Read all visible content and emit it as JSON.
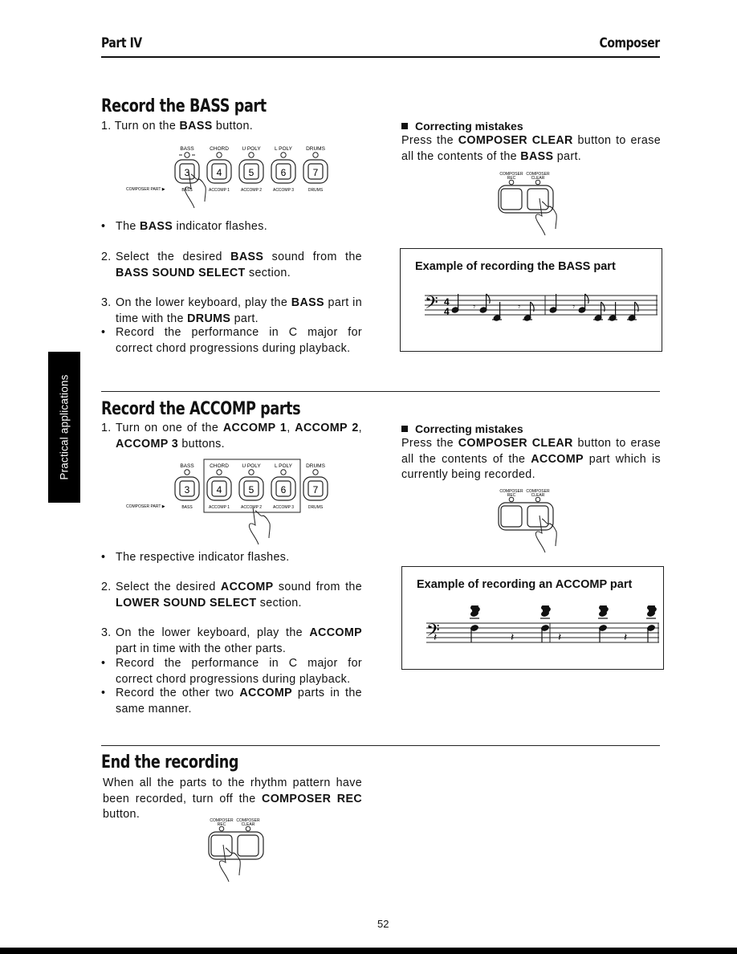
{
  "header": {
    "left": "Part IV",
    "right": "Composer"
  },
  "side_tab": "Practical applications",
  "page_number": "52",
  "panel": {
    "composer_part_label": "COMPOSER PART ▶",
    "buttons": [
      {
        "top": "BASS",
        "num": "3",
        "bottom": "BASS"
      },
      {
        "top": "CHORD",
        "num": "4",
        "bottom": "ACCOMP 1"
      },
      {
        "top": "U POLY",
        "num": "5",
        "bottom": "ACCOMP 2"
      },
      {
        "top": "L POLY",
        "num": "6",
        "bottom": "ACCOMP 3"
      },
      {
        "top": "DRUMS",
        "num": "7",
        "bottom": "DRUMS"
      }
    ],
    "composer_rec_top": "COMPOSER",
    "composer_rec_bottom": "REC",
    "composer_clear_top": "COMPOSER",
    "composer_clear_bottom": "CLEAR"
  },
  "bass": {
    "title": "Record the BASS part",
    "step1": {
      "num": "1.",
      "pre": "Turn on the ",
      "b1": "BASS",
      "post": " button."
    },
    "bullet1": {
      "pre": "The ",
      "b1": "BASS",
      "post": " indicator flashes."
    },
    "step2": {
      "num": "2.",
      "pre": "Select the desired ",
      "b1": "BASS",
      "mid": " sound from the ",
      "b2": "BASS SOUND SELECT",
      "post": " section."
    },
    "step3": {
      "num": "3.",
      "pre": "On the lower keyboard, play the ",
      "b1": "BASS",
      "mid": " part in time with the ",
      "b2": "DRUMS",
      "post": " part."
    },
    "bullet2": "Record the performance in C major for correct chord progressions during playback.",
    "correcting": {
      "title": "Correcting mistakes",
      "pre": "Press the ",
      "b1": "COMPOSER CLEAR",
      "mid": " button to erase all the contents of the ",
      "b2": "BASS",
      "post": " part."
    },
    "example_title": "Example of recording the BASS part"
  },
  "accomp": {
    "title": "Record the ACCOMP parts",
    "step1": {
      "num": "1.",
      "pre": "Turn on one of the ",
      "b1": "ACCOMP 1",
      "mid": ", ",
      "b2": "ACCOMP 2",
      "mid2": ", ",
      "b3": "ACCOMP 3",
      "post": " buttons."
    },
    "bullet1": "The respective indicator flashes.",
    "step2": {
      "num": "2.",
      "pre": "Select the desired ",
      "b1": "ACCOMP",
      "mid": " sound from the ",
      "b2": "LOWER SOUND SELECT",
      "post": " section."
    },
    "step3": {
      "num": "3.",
      "pre": "On the lower keyboard, play the ",
      "b1": "ACCOMP",
      "post": " part in time with the other parts."
    },
    "bullet2": "Record the performance in C major for correct chord progressions during playback.",
    "bullet3": {
      "pre": "Record the other two ",
      "b1": "ACCOMP",
      "post": " parts in the same manner."
    },
    "correcting": {
      "title": "Correcting mistakes",
      "pre": "Press the ",
      "b1": "COMPOSER CLEAR",
      "mid": " button to erase all the contents of the ",
      "b2": "ACCOMP",
      "post": " part which is currently being recorded."
    },
    "example_title": "Example of recording an ACCOMP part"
  },
  "end": {
    "title": "End the recording",
    "pre": "When all the parts to the rhythm pattern have been recorded, turn off the ",
    "b1": "COMPOSER REC",
    "post": " button."
  }
}
